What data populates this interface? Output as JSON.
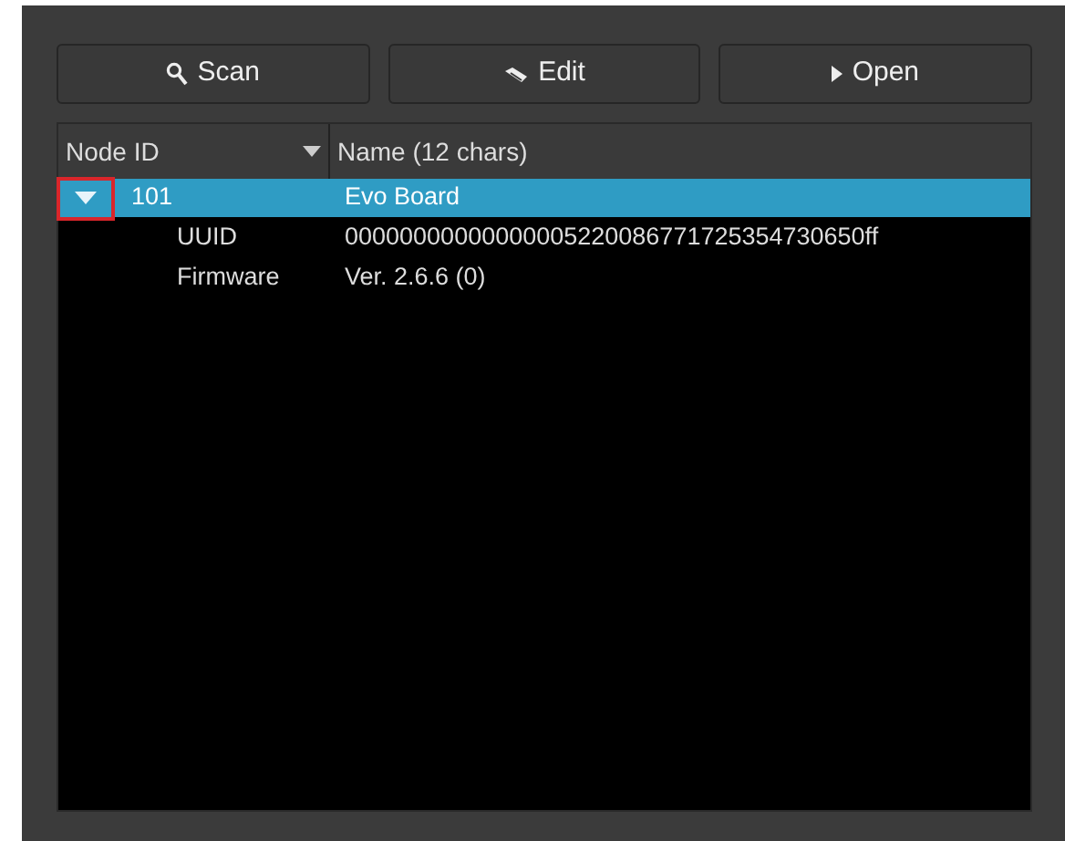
{
  "toolbar": [
    {
      "label": "Scan"
    },
    {
      "label": "Edit"
    },
    {
      "label": "Open"
    }
  ],
  "tree": {
    "columns": [
      {
        "label": "Node ID"
      },
      {
        "label": "Name  (12 chars)"
      }
    ],
    "rows": [
      {
        "id": "101",
        "name": "Evo Board",
        "selected": true,
        "expanded": true,
        "highlighted": true,
        "children": [
          {
            "label": "UUID",
            "value": "00000000000000005220086771725354730650ff"
          },
          {
            "label": "Firmware",
            "value": "Ver. 2.6.6 (0)"
          }
        ]
      }
    ]
  }
}
